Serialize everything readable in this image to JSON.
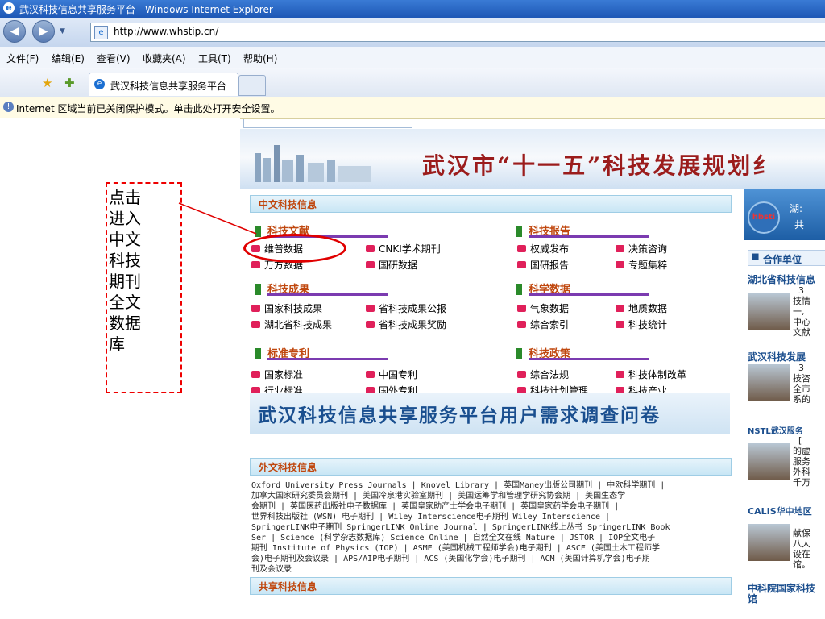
{
  "window": {
    "title": "武汉科技信息共享服务平台 - Windows Internet Explorer"
  },
  "address": {
    "url": "http://www.whstip.cn/"
  },
  "menu": [
    "文件(F)",
    "编辑(E)",
    "查看(V)",
    "收藏夹(A)",
    "工具(T)",
    "帮助(H)"
  ],
  "tab": {
    "label": "武汉科技信息共享服务平台"
  },
  "infobar": {
    "text": "Internet 区域当前已关闭保护模式。单击此处打开安全设置。"
  },
  "annotation": {
    "text": "点击\n进入\n中文\n科技\n期刊\n全文\n数据\n库"
  },
  "banner": {
    "title": "武汉市“十一五”科技发展规划纟"
  },
  "chinese_section": {
    "header": "中文科技信息",
    "groups": [
      {
        "title": "科技文献",
        "items": [
          "维普数据",
          "CNKI学术期刊",
          "万方数据",
          "国研数据"
        ]
      },
      {
        "title": "科技报告",
        "items": [
          "权威发布",
          "决策咨询",
          "国研报告",
          "专题集粹"
        ]
      },
      {
        "title": "科技成果",
        "items": [
          "国家科技成果",
          "省科技成果公报",
          "湖北省科技成果",
          "省科技成果奖励"
        ]
      },
      {
        "title": "科学数据",
        "items": [
          "气象数据",
          "地质数据",
          "综合索引",
          "科技统计"
        ]
      },
      {
        "title": "标准专利",
        "items": [
          "国家标准",
          "中国专利",
          "行业标准",
          "国外专利"
        ]
      },
      {
        "title": "科技政策",
        "items": [
          "综合法规",
          "科技体制改革",
          "科技计划管理",
          "科技产业"
        ]
      }
    ]
  },
  "survey": {
    "title": "武汉科技信息共享服务平台用户需求调查问卷"
  },
  "foreign_section": {
    "header": "外文科技信息",
    "text": "Oxford University Press Journals | Knovel Library | 英国Maney出版公司期刊 | 中欧科学期刊 |\n加拿大国家研究委员会期刊 | 美国冷泉港实验室期刊 | 美国运筹学和管理学研究协会期 | 美国生态学\n会期刊 | 英国医药出版社电子数据库 | 英国皇家助产士学会电子期刊 | 英国皇家药学会电子期刊 |\n世界科技出版社 (WSN) 电子期刊 | Wiley Interscience电子期刊 Wiley Interscience |\nSpringerLINK电子期刊 SpringerLINK Online Journal | SpringerLINK线上丛书 SpringerLINK Book\nSer | Science (科学杂志数据库) Science Online | 自然全文在线 Nature | JSTOR | IOP全文电子\n期刊 Institute of Physics (IOP) | ASME (美国机械工程师学会)电子期刊 | ASCE (美国土木工程师学\n会)电子期刊及会议录 | APS/AIP电子期刊 | ACS (美国化学会)电子期刊 | ACM (美国计算机学会)电子期\n刊及会议录"
  },
  "shared_section": {
    "header": "共享科技信息"
  },
  "right": {
    "logo": "hbsti",
    "logo_t1": "湖:",
    "logo_t2": "共",
    "coop_header": "合作单位",
    "entries": [
      {
        "name": "湖北省科技信息",
        "text": "  3\n技情\n一,\n中心\n文献"
      },
      {
        "name": "武汉科技发展",
        "text": "  3\n技咨\n全市\n系的"
      },
      {
        "name": "NSTL武汉服务",
        "text": "  [\n的虚\n服务\n外科\n千万"
      },
      {
        "name": "CALIS华中地区",
        "text": "  \n献保\n八大\n设在\n馆。"
      },
      {
        "name": "中科院国家科技\n馆",
        "text": ""
      }
    ]
  },
  "colors": {
    "accent_red": "#e00000",
    "title_red": "#9b1c1c",
    "section_orange": "#c0470e",
    "survey_blue": "#1a4f8f"
  }
}
